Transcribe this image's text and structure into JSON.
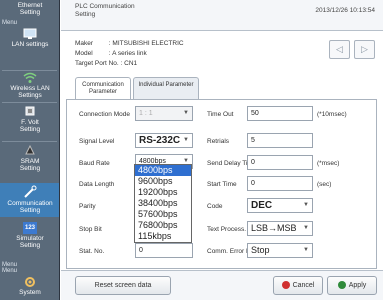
{
  "sidebar": {
    "items": [
      {
        "label": "Ethernet\nSetting"
      },
      {
        "label": "LAN settings"
      },
      {
        "label": "Wireless LAN\nSettings"
      },
      {
        "label": "F. Volt\nSetting"
      },
      {
        "label": "SRAM\nSetting"
      },
      {
        "label": "Communication\nSetting"
      },
      {
        "label": "Simulator\nSetting"
      },
      {
        "label": "System"
      }
    ],
    "menu_tags": [
      "Menu",
      "Menu",
      "Menu"
    ],
    "simulator_badge": "123"
  },
  "header": {
    "title": "PLC Communication\nSetting",
    "datetime": "2013/12/26 10:13:54"
  },
  "info": {
    "maker_label": "Maker",
    "maker_value": "MITSUBISHI ELECTRIC",
    "model_label": "Model",
    "model_value": "A series link",
    "port_label": "Target Port No.",
    "port_value": "CN1"
  },
  "nav": {
    "prev_icon": "◁",
    "next_icon": "▷"
  },
  "tabs": [
    {
      "label": "Communication\nParameter"
    },
    {
      "label": "Individual Parameter"
    }
  ],
  "form": {
    "conn_mode_label": "Connection Mode",
    "conn_mode_value": "1 : 1",
    "signal_label": "Signal Level",
    "signal_value": "RS-232C",
    "baud_label": "Baud Rate",
    "baud_value": "4800bps",
    "data_len_label": "Data Length",
    "parity_label": "Parity",
    "stop_bit_label": "Stop Bit",
    "stat_no_label": "Stat. No.",
    "stat_no_value": "0",
    "timeout_label": "Time Out",
    "timeout_value": "50",
    "timeout_unit": "(*10msec)",
    "retrials_label": "Retrials",
    "retrials_value": "5",
    "send_delay_label": "Send Delay Time",
    "send_delay_value": "0",
    "send_delay_unit": "(*msec)",
    "start_time_label": "Start Time",
    "start_time_value": "0",
    "start_time_unit": "(sec)",
    "code_label": "Code",
    "code_value": "DEC",
    "text_process_label": "Text Process.",
    "text_process_value": "LSB→MSB",
    "err_handling_label": "Comm. Error Handling",
    "err_handling_value": "Stop"
  },
  "baud_options": [
    "4800bps",
    "9600bps",
    "19200bps",
    "38400bps",
    "57600bps",
    "76800bps",
    "115kbps"
  ],
  "baud_selected": "4800bps",
  "buttons": {
    "reset": "Reset screen data",
    "cancel": "Cancel",
    "apply": "Apply"
  },
  "colors": {
    "sidebar_bg": "#5a6a7a",
    "sidebar_active": "#3f7fb8",
    "dropdown_selected": "#2f6fd0",
    "cancel_icon": "#d03030",
    "apply_icon": "#2f8a3a"
  }
}
